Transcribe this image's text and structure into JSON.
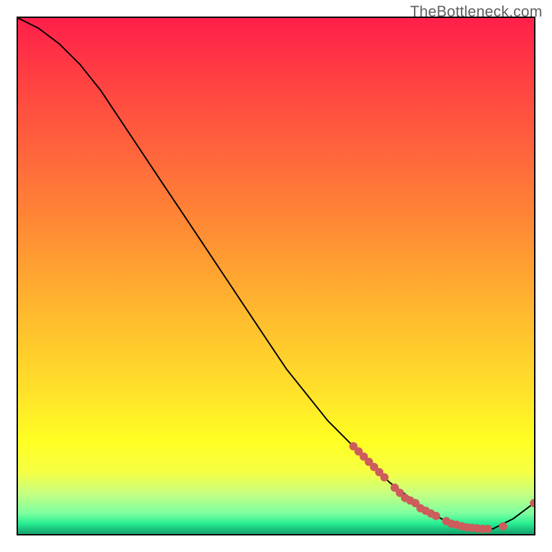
{
  "watermark": "TheBottleneck.com",
  "chart_data": {
    "type": "line",
    "title": "",
    "xlabel": "",
    "ylabel": "",
    "xlim": [
      0,
      100
    ],
    "ylim": [
      0,
      100
    ],
    "legend": false,
    "grid": false,
    "background": "vertical-gradient red→yellow→green",
    "series": [
      {
        "name": "bottleneck-curve",
        "color": "#000000",
        "x": [
          0,
          4,
          8,
          12,
          16,
          20,
          24,
          28,
          32,
          36,
          40,
          44,
          48,
          52,
          56,
          60,
          64,
          68,
          72,
          76,
          80,
          84,
          88,
          92,
          96,
          100
        ],
        "y": [
          100,
          98,
          95,
          91,
          86,
          80,
          74,
          68,
          62,
          56,
          50,
          44,
          38,
          32,
          27,
          22,
          18,
          14,
          10,
          7,
          4,
          2,
          1,
          1,
          3,
          6
        ]
      }
    ],
    "markers": {
      "name": "highlighted-points",
      "color": "#cd5c5c",
      "radius_px": 6,
      "points": [
        {
          "x": 65,
          "y": 17
        },
        {
          "x": 66,
          "y": 16
        },
        {
          "x": 67,
          "y": 15
        },
        {
          "x": 68,
          "y": 14
        },
        {
          "x": 69,
          "y": 13
        },
        {
          "x": 70,
          "y": 12
        },
        {
          "x": 71,
          "y": 11
        },
        {
          "x": 73,
          "y": 9
        },
        {
          "x": 74,
          "y": 8
        },
        {
          "x": 75,
          "y": 7
        },
        {
          "x": 76,
          "y": 6.5
        },
        {
          "x": 77,
          "y": 6
        },
        {
          "x": 78,
          "y": 5
        },
        {
          "x": 79,
          "y": 4.5
        },
        {
          "x": 80,
          "y": 4
        },
        {
          "x": 81,
          "y": 3.5
        },
        {
          "x": 83,
          "y": 2.5
        },
        {
          "x": 84,
          "y": 2
        },
        {
          "x": 85,
          "y": 1.8
        },
        {
          "x": 86,
          "y": 1.5
        },
        {
          "x": 87,
          "y": 1.3
        },
        {
          "x": 88,
          "y": 1.2
        },
        {
          "x": 89,
          "y": 1.1
        },
        {
          "x": 90,
          "y": 1
        },
        {
          "x": 91,
          "y": 1
        },
        {
          "x": 94,
          "y": 1.5
        },
        {
          "x": 100,
          "y": 6
        }
      ]
    }
  }
}
